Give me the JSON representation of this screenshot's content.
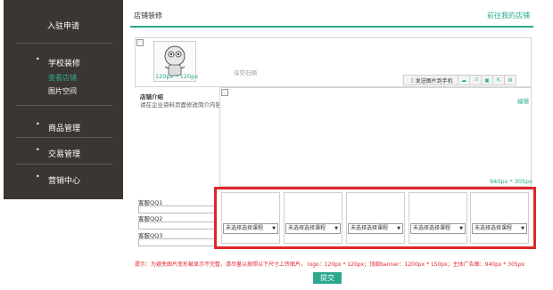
{
  "sidebar": {
    "top_label": "入驻申请",
    "groups": [
      {
        "label": "学校装修",
        "subs": [
          "查看店铺",
          "图片空间"
        ]
      },
      {
        "label": "商品管理"
      },
      {
        "label": "交易管理"
      },
      {
        "label": "营销中心"
      }
    ],
    "bullet": "•",
    "active_color": "#2aa88e",
    "bg_color": "#3b3634"
  },
  "header": {
    "title": "店铺装修",
    "link": "前往我的店铺"
  },
  "banner": {
    "logo_size": "120px * 120px",
    "store_name": "深空石楠",
    "send_label": "发送图片到手机"
  },
  "intro": {
    "title": "店铺介绍",
    "desc": "请在企业资料页面修改简介内容"
  },
  "ad": {
    "edit_label": "编辑",
    "size_label": "940px * 305px"
  },
  "qq": {
    "labels": [
      "客服QQ1",
      "客服QQ2",
      "客服QQ3"
    ]
  },
  "selects": {
    "option": "未选择选择课程"
  },
  "footer": {
    "tip": "提示：为避免图片变形被显示不完整，请尽量以按照以下尺寸上传图片。 logo：120px * 120px；顶部banner：1200px * 150px；主体广告图：940px * 305px",
    "submit": "提交"
  },
  "icons": [
    "phone-icon",
    "cloud-icon",
    "shuffle-icon",
    "save-icon",
    "export-icon",
    "settings-icon"
  ],
  "accent_color": "#2aa88e",
  "highlight_color": "#e0262b"
}
